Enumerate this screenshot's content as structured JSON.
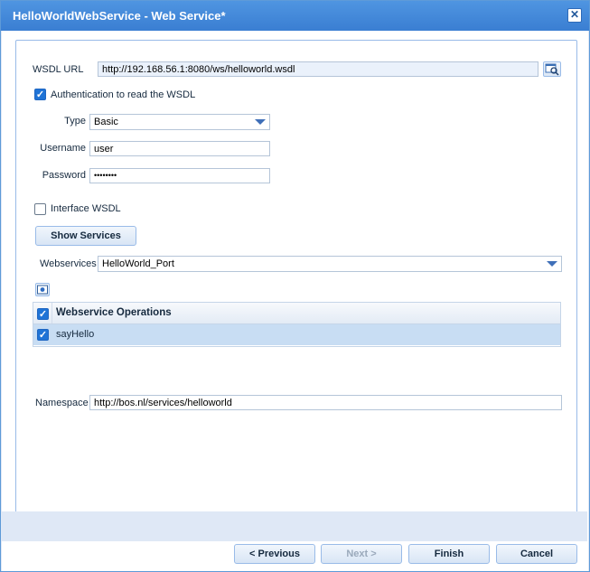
{
  "window": {
    "title": "HelloWorldWebService - Web Service*",
    "close_glyph": "✕"
  },
  "form": {
    "wsdl_url": {
      "label": "WSDL URL",
      "value": "http://192.168.56.1:8080/ws/helloworld.wsdl"
    },
    "auth": {
      "label": "Authentication to read the WSDL",
      "checked": true
    },
    "type": {
      "label": "Type",
      "value": "Basic"
    },
    "username": {
      "label": "Username",
      "value": "user"
    },
    "password": {
      "label": "Password",
      "value": "••••••••"
    },
    "interface": {
      "label": "Interface WSDL",
      "checked": false
    },
    "show_services": {
      "label": "Show Services"
    },
    "webservices": {
      "label": "Webservices",
      "value": "HelloWorld_Port"
    },
    "operations": {
      "header": "Webservice Operations",
      "rows": [
        {
          "name": "sayHello",
          "checked": true
        }
      ]
    },
    "namespace": {
      "label": "Namespace",
      "value": "http://bos.nl/services/helloworld"
    }
  },
  "footer": {
    "previous": "< Previous",
    "next": "Next >",
    "finish": "Finish",
    "cancel": "Cancel"
  },
  "colors": {
    "accent": "#1f73d6",
    "title_bar": "#4a8fdc",
    "selected_row": "#c8ddf3"
  }
}
